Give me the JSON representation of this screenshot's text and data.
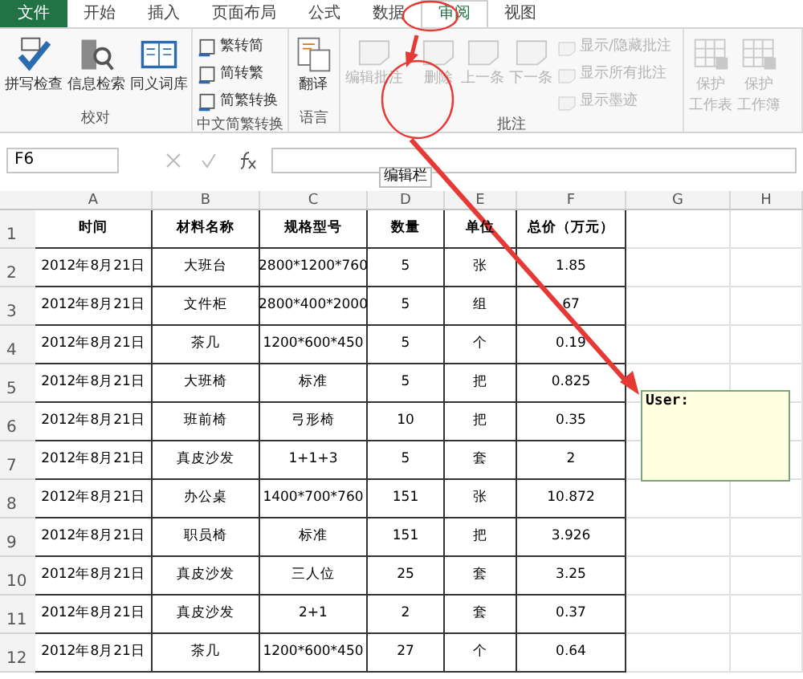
{
  "file_menu": {
    "label": "文件"
  },
  "tabs": [
    {
      "label": "开始",
      "selected": false
    },
    {
      "label": "插入",
      "selected": false
    },
    {
      "label": "页面布局",
      "selected": false
    },
    {
      "label": "公式",
      "selected": false
    },
    {
      "label": "数据",
      "selected": false
    },
    {
      "label": "审阅",
      "selected": true
    },
    {
      "label": "视图",
      "selected": false
    }
  ],
  "ribbon_groups": [
    {
      "name": "校对",
      "items": [
        {
          "label": "拼写检查",
          "kind": "large",
          "disabled": false
        },
        {
          "label": "信息检索",
          "kind": "large",
          "disabled": false
        },
        {
          "label": "同义词库",
          "kind": "large",
          "disabled": false
        }
      ]
    },
    {
      "name": "中文简繁转换",
      "items": [
        {
          "label": "繁转简",
          "kind": "small",
          "disabled": false
        },
        {
          "label": "简转繁",
          "kind": "small",
          "disabled": false
        },
        {
          "label": "简繁转换",
          "kind": "small",
          "disabled": false
        }
      ]
    },
    {
      "name": "语言",
      "items": [
        {
          "label": "翻译",
          "kind": "large",
          "disabled": false
        }
      ]
    },
    {
      "name": "批注",
      "items": [
        {
          "label": "编辑批注",
          "kind": "large",
          "disabled": true
        },
        {
          "label": "删除",
          "kind": "large",
          "disabled": true
        },
        {
          "label": "上一条",
          "kind": "large",
          "disabled": true
        },
        {
          "label": "下一条",
          "kind": "large",
          "disabled": true
        },
        {
          "label": "显示/隐藏批注",
          "kind": "small",
          "disabled": true
        },
        {
          "label": "显示所有批注",
          "kind": "small",
          "disabled": true
        },
        {
          "label": "显示墨迹",
          "kind": "small",
          "disabled": true
        }
      ]
    },
    {
      "items": [
        {
          "label_lines": [
            "保护",
            "工作表"
          ],
          "kind": "large",
          "disabled": true
        },
        {
          "label_lines": [
            "保护",
            "工作簿"
          ],
          "kind": "large",
          "disabled": true
        }
      ]
    }
  ],
  "formula_bar": {
    "name_box": "F6",
    "tooltip": "编辑栏"
  },
  "columns": [
    "A",
    "B",
    "C",
    "D",
    "E",
    "F",
    "G",
    "H"
  ],
  "rows": [
    {
      "number": "1",
      "cells": [
        "时间",
        "材料名称",
        "规格型号",
        "数量",
        "单位",
        "总价（万元）"
      ]
    },
    {
      "number": "2",
      "cells": [
        "2012年8月21日",
        "大班台",
        "2800*1200*760",
        "5",
        "张",
        "1.85"
      ]
    },
    {
      "number": "3",
      "cells": [
        "2012年8月21日",
        "文件柜",
        "2800*400*2000",
        "5",
        "组",
        "67"
      ]
    },
    {
      "number": "4",
      "cells": [
        "2012年8月21日",
        "茶几",
        "1200*600*450",
        "5",
        "个",
        "0.19"
      ]
    },
    {
      "number": "5",
      "cells": [
        "2012年8月21日",
        "大班椅",
        "标准",
        "5",
        "把",
        "0.825"
      ]
    },
    {
      "number": "6",
      "cells": [
        "2012年8月21日",
        "班前椅",
        "弓形椅",
        "10",
        "把",
        "0.35"
      ]
    },
    {
      "number": "7",
      "cells": [
        "2012年8月21日",
        "真皮沙发",
        "1+1+3",
        "5",
        "套",
        "2"
      ]
    },
    {
      "number": "8",
      "cells": [
        "2012年8月21日",
        "办公桌",
        "1400*700*760",
        "151",
        "张",
        "10.872"
      ]
    },
    {
      "number": "9",
      "cells": [
        "2012年8月21日",
        "职员椅",
        "标准",
        "151",
        "把",
        "3.926"
      ]
    },
    {
      "number": "10",
      "cells": [
        "2012年8月21日",
        "真皮沙发",
        "三人位",
        "25",
        "套",
        "3.25"
      ]
    },
    {
      "number": "11",
      "cells": [
        "2012年8月21日",
        "真皮沙发",
        "2+1",
        "2",
        "套",
        "0.37"
      ]
    },
    {
      "number": "12",
      "cells": [
        "2012年8月21日",
        "茶几",
        "1200*600*450",
        "27",
        "个",
        "0.64"
      ]
    }
  ],
  "comment": {
    "author": "User:"
  }
}
